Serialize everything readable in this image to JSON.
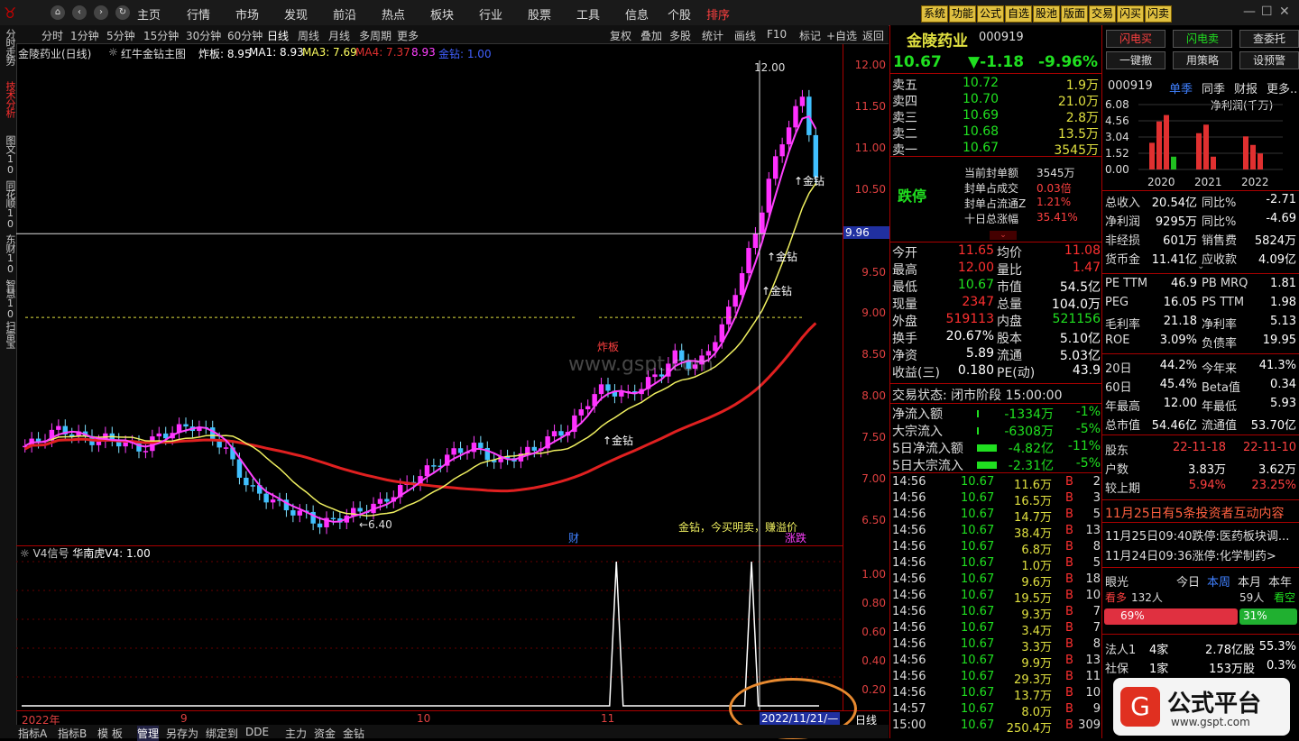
{
  "topnav": {
    "items": [
      "主页",
      "行情",
      "市场",
      "发现",
      "前沿",
      "热点",
      "板块",
      "行业",
      "股票",
      "工具",
      "信息",
      "个股",
      "排序"
    ],
    "active_index": 12,
    "tool_buttons": [
      "系统",
      "功能",
      "公式",
      "自选",
      "股池",
      "版面",
      "交易",
      "闪买",
      "闪卖"
    ]
  },
  "lefttabs": [
    "分时走势",
    "技术分析",
    "图文10",
    "同花顺10",
    "东财10",
    "智慧10",
    "扫雷宝"
  ],
  "periods": [
    "分时",
    "1分钟",
    "5分钟",
    "15分钟",
    "30分钟",
    "60分钟",
    "日线",
    "周线",
    "月线",
    "多周期",
    "更多"
  ],
  "chart_tools": [
    "复权",
    "叠加",
    "多股",
    "统计",
    "画线",
    "F10",
    "标记",
    "+自选",
    "返回"
  ],
  "chart_info": {
    "stock": "金陵药业(日线)",
    "indicator": "红牛金钻主图",
    "zhaban": "炸板: 8.95",
    "ma1": "MA1: 8.93",
    "ma3": "MA3: 7.69",
    "ma4": "MA4: 7.37",
    "v893": "8.93",
    "jinzuan": "金钻: 1.00"
  },
  "chart_labels": {
    "high": "12.00",
    "low": "6.40",
    "cursor_price": "9.96",
    "zhaban_tag": "炸板",
    "jinzuan_tags": [
      "金钻",
      "金钻",
      "金钻",
      "金钻"
    ],
    "legend": "金钻，今买明卖，赚溢价",
    "cai": "财",
    "zhangdie": "涨跌",
    "watermark": "www.gspt.com"
  },
  "sub_chart": {
    "title": "V4信号",
    "name": "华南虎V4: 1.00",
    "ticks": [
      "1.00",
      "0.80",
      "0.60",
      "0.40",
      "0.20"
    ]
  },
  "chart_data": {
    "type": "candlestick",
    "y_ticks": [
      "12.00",
      "11.50",
      "11.00",
      "10.50",
      "10.00",
      "9.50",
      "9.00",
      "8.50",
      "8.00",
      "7.50",
      "7.00",
      "6.50"
    ],
    "ylim": [
      6.2,
      12.05
    ],
    "x_labels": [
      "2022年",
      "9",
      "10",
      "11"
    ],
    "cursor_date": "2022/11/21/—",
    "period_label": "日线",
    "v4_signal": [
      0,
      0,
      0,
      0,
      0,
      0,
      0,
      0,
      0,
      0,
      0,
      0,
      0,
      0,
      0,
      0,
      0,
      0,
      0,
      0,
      0,
      0,
      0,
      0,
      0,
      0,
      0,
      0,
      0,
      0,
      0,
      0,
      0,
      0,
      0,
      0,
      0,
      0,
      0,
      0,
      0,
      0,
      0,
      0,
      0,
      0,
      0,
      0,
      0,
      0,
      0,
      0,
      0,
      0,
      0,
      0,
      0,
      0,
      0,
      0,
      0,
      0,
      0,
      0,
      0,
      0,
      0,
      0,
      0,
      0,
      0,
      0,
      0,
      0,
      0,
      0,
      0,
      0,
      0,
      0,
      0,
      0,
      0,
      0,
      0,
      0,
      0,
      0,
      1,
      0,
      0,
      0,
      0,
      0,
      0,
      0,
      0,
      0,
      0,
      0,
      0,
      0,
      0,
      0,
      0,
      0,
      0,
      0,
      1,
      0,
      0,
      0,
      0,
      0,
      0,
      0,
      0,
      0,
      0
    ]
  },
  "bottom_tabs": [
    "指标A",
    "指标B",
    "模 板",
    "管理",
    "另存为",
    "绑定到",
    "DDE",
    "主力",
    "资金",
    "金钻"
  ],
  "quote": {
    "name": "金陵药业",
    "code": "000919",
    "price": "10.67",
    "change": "▼-1.18",
    "pct": "-9.96%",
    "asks": [
      {
        "label": "卖五",
        "price": "10.72",
        "vol": "1.9万"
      },
      {
        "label": "卖四",
        "price": "10.70",
        "vol": "21.0万"
      },
      {
        "label": "卖三",
        "price": "10.69",
        "vol": "2.8万"
      },
      {
        "label": "卖二",
        "price": "10.68",
        "vol": "13.5万"
      },
      {
        "label": "卖一",
        "price": "10.67",
        "vol": "3545万"
      }
    ],
    "limit_status": "跌停",
    "limit_info": [
      {
        "k": "当前封单额",
        "v": "3545万"
      },
      {
        "k": "封单占成交",
        "v": "0.03倍"
      },
      {
        "k": "封单占流通Z",
        "v": "1.21%"
      },
      {
        "k": "十日总涨幅",
        "v": "35.41%"
      }
    ],
    "stats": [
      {
        "k1": "今开",
        "v1": "11.65",
        "k2": "均价",
        "v2": "11.08"
      },
      {
        "k1": "最高",
        "v1": "12.00",
        "k2": "量比",
        "v2": "1.47"
      },
      {
        "k1": "最低",
        "v1": "10.67",
        "k2": "市值",
        "v2": "54.5亿"
      },
      {
        "k1": "现量",
        "v1": "2347",
        "k2": "总量",
        "v2": "104.0万"
      },
      {
        "k1": "外盘",
        "v1": "519113",
        "k2": "内盘",
        "v2": "521156"
      },
      {
        "k1": "换手",
        "v1": "20.67%",
        "k2": "股本",
        "v2": "5.10亿"
      },
      {
        "k1": "净资",
        "v1": "5.89",
        "k2": "流通",
        "v2": "5.03亿"
      },
      {
        "k1": "收益(三)",
        "v1": "0.180",
        "k2": "PE(动)",
        "v2": "43.9"
      }
    ],
    "trade_status": "交易状态: 闭市阶段 15:00:00",
    "flows": [
      {
        "k": "净流入额",
        "v": "-1334万",
        "p": "-1%"
      },
      {
        "k": "大宗流入",
        "v": "-6308万",
        "p": "-5%"
      },
      {
        "k": "5日净流入额",
        "v": "-4.82亿",
        "p": "-11%"
      },
      {
        "k": "5日大宗流入",
        "v": "-2.31亿",
        "p": "-5%"
      }
    ],
    "ticks": [
      {
        "t": "14:56",
        "p": "10.67",
        "v": "11.6万",
        "n": "2"
      },
      {
        "t": "14:56",
        "p": "10.67",
        "v": "16.5万",
        "n": "3"
      },
      {
        "t": "14:56",
        "p": "10.67",
        "v": "14.7万",
        "n": "5"
      },
      {
        "t": "14:56",
        "p": "10.67",
        "v": "38.4万",
        "n": "13"
      },
      {
        "t": "14:56",
        "p": "10.67",
        "v": "6.8万",
        "n": "8"
      },
      {
        "t": "14:56",
        "p": "10.67",
        "v": "1.0万",
        "n": "5"
      },
      {
        "t": "14:56",
        "p": "10.67",
        "v": "9.6万",
        "n": "18"
      },
      {
        "t": "14:56",
        "p": "10.67",
        "v": "19.5万",
        "n": "10"
      },
      {
        "t": "14:56",
        "p": "10.67",
        "v": "9.3万",
        "n": "7"
      },
      {
        "t": "14:56",
        "p": "10.67",
        "v": "3.4万",
        "n": "7"
      },
      {
        "t": "14:56",
        "p": "10.67",
        "v": "3.3万",
        "n": "8"
      },
      {
        "t": "14:56",
        "p": "10.67",
        "v": "9.9万",
        "n": "13"
      },
      {
        "t": "14:56",
        "p": "10.67",
        "v": "29.3万",
        "n": "11"
      },
      {
        "t": "14:56",
        "p": "10.67",
        "v": "13.7万",
        "n": "10"
      },
      {
        "t": "14:57",
        "p": "10.67",
        "v": "8.0万",
        "n": "9"
      },
      {
        "t": "15:00",
        "p": "10.67",
        "v": "250.4万",
        "n": "309"
      }
    ]
  },
  "far": {
    "buttons": [
      "闪电买",
      "闪电卖",
      "查委托",
      "一键撤",
      "用策略",
      "设预警"
    ],
    "code": "000919",
    "tabs": [
      "单季",
      "同季",
      "财报",
      "更多.."
    ],
    "chart_title": "净利润(千万)",
    "bar_ticks": [
      "6.08",
      "4.56",
      "3.04",
      "1.52",
      "0.00"
    ],
    "bar_years": [
      "2020",
      "2021",
      "2022"
    ],
    "bar_values": [
      2.5,
      4.5,
      5.1,
      1.2,
      3.4,
      4.2,
      1.2,
      3.1,
      2.3,
      1.5
    ],
    "fin": [
      {
        "k1": "总收入",
        "v1": "20.54亿",
        "k2": "同比%",
        "v2": "-2.71"
      },
      {
        "k1": "净利润",
        "v1": "9295万",
        "k2": "同比%",
        "v2": "-4.69"
      },
      {
        "k1": "非经损",
        "v1": "601万",
        "k2": "销售费",
        "v2": "5824万"
      },
      {
        "k1": "货币金",
        "v1": "11.41亿",
        "k2": "应收款",
        "v2": "4.09亿"
      }
    ],
    "ratios": [
      {
        "k1": "PE TTM",
        "v1": "46.9",
        "k2": "PB MRQ",
        "v2": "1.81"
      },
      {
        "k1": "PEG",
        "v1": "16.05",
        "k2": "PS TTM",
        "v2": "1.98"
      },
      {
        "k1": "毛利率",
        "v1": "21.18",
        "k2": "净利率",
        "v2": "5.13"
      },
      {
        "k1": "ROE",
        "v1": "3.09%",
        "k2": "负债率",
        "v2": "19.95"
      }
    ],
    "perf": [
      {
        "k1": "20日",
        "v1": "44.2%",
        "k2": "今年来",
        "v2": "41.3%"
      },
      {
        "k1": "60日",
        "v1": "45.4%",
        "k2": "Beta值",
        "v2": "0.34"
      },
      {
        "k1": "年最高",
        "v1": "12.00",
        "k2": "年最低",
        "v2": "5.93"
      },
      {
        "k1": "总市值",
        "v1": "54.46亿",
        "k2": "流通值",
        "v2": "53.70亿"
      }
    ],
    "holders": [
      {
        "k": "股东",
        "v1": "22-11-18",
        "v2": "22-11-10"
      },
      {
        "k": "户数",
        "v1": "3.83万",
        "v2": "3.62万"
      },
      {
        "k": "较上期",
        "v1": "5.94%",
        "v2": "23.25%"
      }
    ],
    "news_head": "11月25日有5条投资者互动内容",
    "news": [
      "11月25日09:40跌停:医药板块调...",
      "11月24日09:36涨停:化学制药>"
    ],
    "eye": {
      "title": "眼光",
      "tabs": [
        "今日",
        "本周",
        "本月",
        "本年"
      ],
      "bull": "看多",
      "bull_n": "132人",
      "bear_n": "59人",
      "bear": "看空",
      "bull_pct": "69%",
      "bear_pct": "31%"
    },
    "org": [
      {
        "k": "法人1",
        "n": "4家",
        "v": "2.78亿股",
        "p": "55.3%"
      },
      {
        "k": "社保",
        "n": "1家",
        "v": "153万股",
        "p": "0.3%"
      }
    ],
    "badge": "公式平台",
    "badge_url": "www.gspt.com"
  }
}
